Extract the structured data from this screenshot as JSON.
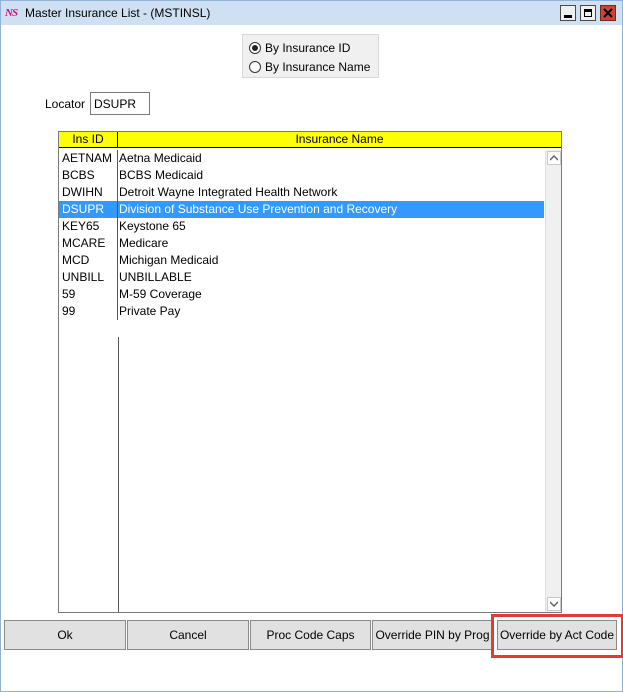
{
  "window": {
    "app_icon": "NS",
    "title": "Master Insurance List - (MSTINSL)",
    "controls": [
      "minimize-icon",
      "maximize-icon",
      "close-icon"
    ],
    "accent_color": "#3399ff",
    "header_color": "#ffff00"
  },
  "sort_options": {
    "selected": "By Insurance ID",
    "options": [
      {
        "label": "By Insurance ID",
        "checked": true
      },
      {
        "label": "By Insurance Name",
        "checked": false
      }
    ]
  },
  "locator": {
    "label": "Locator",
    "value": "DSUPR"
  },
  "grid": {
    "columns": [
      "Ins ID",
      "Insurance Name"
    ],
    "rows": [
      {
        "id": "AETNAM",
        "name": "Aetna Medicaid",
        "selected": false
      },
      {
        "id": "BCBS",
        "name": "BCBS Medicaid",
        "selected": false
      },
      {
        "id": "DWIHN",
        "name": "Detroit Wayne Integrated Health Network",
        "selected": false
      },
      {
        "id": "DSUPR",
        "name": "Division of Substance Use Prevention and Recovery",
        "selected": true
      },
      {
        "id": "KEY65",
        "name": "Keystone 65",
        "selected": false
      },
      {
        "id": "MCARE",
        "name": "Medicare",
        "selected": false
      },
      {
        "id": "MCD",
        "name": "Michigan Medicaid",
        "selected": false
      },
      {
        "id": "UNBILL",
        "name": "UNBILLABLE",
        "selected": false
      },
      {
        "id": "59",
        "name": "M-59 Coverage",
        "selected": false
      },
      {
        "id": "99",
        "name": "Private Pay",
        "selected": false
      }
    ]
  },
  "buttons": {
    "ok": "Ok",
    "cancel": "Cancel",
    "proc_code_caps": "Proc Code Caps",
    "override_pin": "Override PIN by Prog",
    "override_act": "Override by Act Code"
  },
  "highlight_color": "#e53935"
}
